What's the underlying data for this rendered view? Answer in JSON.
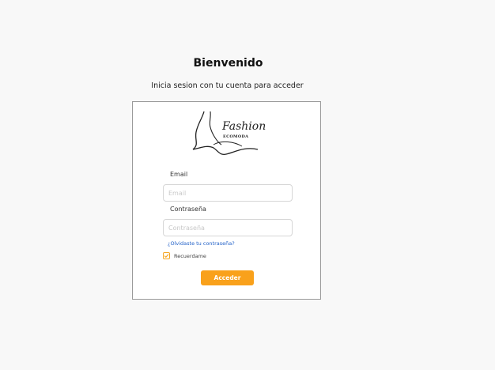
{
  "header": {
    "title": "Bienvenido",
    "subtitle": "Inicia sesion con tu cuenta para acceder"
  },
  "logo": {
    "word": "Fashion",
    "sub": "ECOMODA"
  },
  "form": {
    "email_label": "Email",
    "email_placeholder": "Email",
    "email_value": "",
    "password_label": "Contraseña",
    "password_placeholder": "Contraseña",
    "password_value": "",
    "forgot_link": "¿Olvidaste tu contraseña?",
    "remember_label": "Recuerdame",
    "remember_checked": true,
    "submit_label": "Acceder"
  },
  "colors": {
    "accent": "#f9a11b",
    "link": "#1f5fc7",
    "background": "#f8f8f8"
  }
}
